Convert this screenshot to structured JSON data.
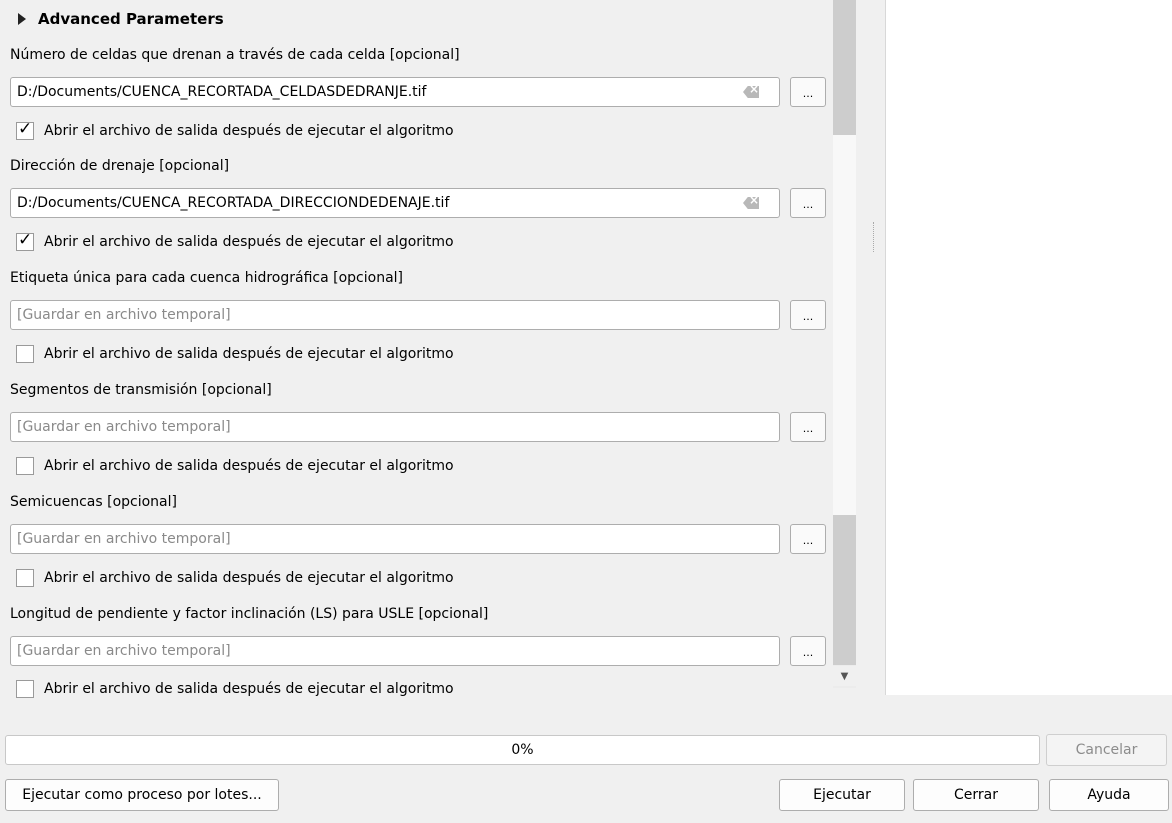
{
  "advanced": {
    "title": "Advanced Parameters"
  },
  "open_label": "Abrir el archivo de salida después de ejecutar el algoritmo",
  "outputs": [
    {
      "label": "Número de celdas que drenan a través de cada celda [opcional]",
      "value": "D:/Documents/CUENCA_RECORTADA_CELDASDEDRANJE.tif",
      "placeholder": "",
      "checked": true
    },
    {
      "label": "Dirección de drenaje [opcional]",
      "value": "D:/Documents/CUENCA_RECORTADA_DIRECCIONDEDENAJE.tif",
      "placeholder": "",
      "checked": true
    },
    {
      "label": "Etiqueta única para cada cuenca hidrográfica [opcional]",
      "value": "",
      "placeholder": "[Guardar en archivo temporal]",
      "checked": false
    },
    {
      "label": "Segmentos de transmisión [opcional]",
      "value": "",
      "placeholder": "[Guardar en archivo temporal]",
      "checked": false
    },
    {
      "label": "Semicuencas [opcional]",
      "value": "",
      "placeholder": "[Guardar en archivo temporal]",
      "checked": false
    },
    {
      "label": "Longitud de pendiente y factor inclinación (LS) para USLE [opcional]",
      "value": "",
      "placeholder": "[Guardar en archivo temporal]",
      "checked": false
    }
  ],
  "browse_label": "...",
  "progress": {
    "text": "0%",
    "value": 0
  },
  "buttons": {
    "cancel": "Cancelar",
    "batch": "Ejecutar como proceso por lotes...",
    "run": "Ejecutar",
    "close": "Cerrar",
    "help": "Ayuda"
  }
}
